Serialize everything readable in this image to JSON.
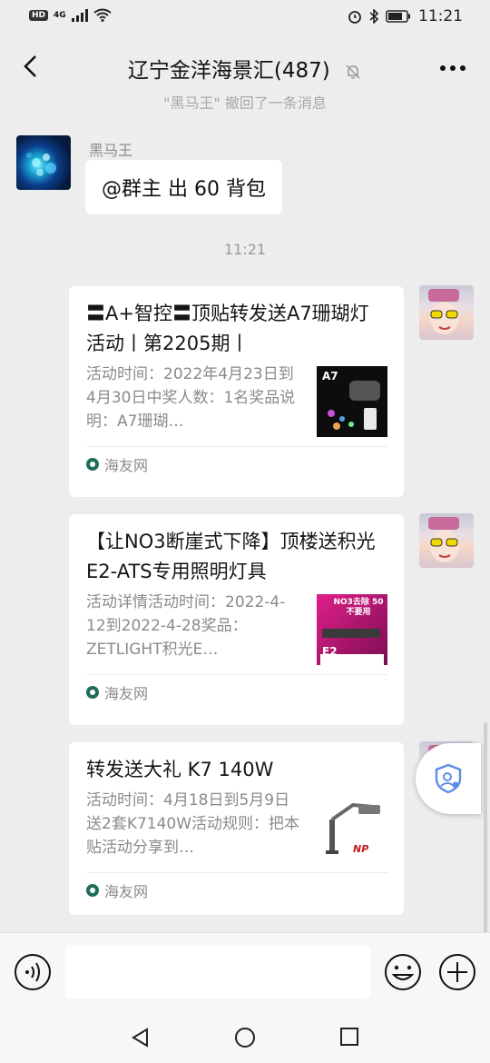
{
  "status_bar": {
    "hd": "HD",
    "network": "4G",
    "time": "11:21"
  },
  "header": {
    "title": "辽宁金洋海景汇(487)",
    "back_icon": "chevron-left-icon",
    "mute_icon": "bell-off-icon",
    "more_icon": "more-dots-icon"
  },
  "system_message": "\"黑马王\" 撤回了一条消息",
  "messages": [
    {
      "sender": "黑马王",
      "text": "@群主  出 60 背包"
    }
  ],
  "timestamp": "11:21",
  "link_cards": [
    {
      "title": "〓A+智控〓顶贴转发送A7珊瑚灯活动丨第2205期丨",
      "desc": "活动时间：2022年4月23日到4月30日中奖人数：1名奖品说明：A7珊瑚…",
      "thumb_text": "A7",
      "source": "海友网"
    },
    {
      "title": "【让NO3断崖式下降】顶楼送积光E2-ATS专用照明灯具",
      "desc": "活动详情活动时间：2022-4-12到2022-4-28奖品：ZETLIGHT积光E…",
      "thumb_text": "NO3去除 50不要用",
      "thumb_sub": "E2",
      "source": "海友网"
    },
    {
      "title": "转发送大礼 K7 140W",
      "desc": "活动时间：4月18日到5月9日送2套K7140W活动规则：把本贴活动分享到…",
      "thumb_text": "NP",
      "source": "海友网"
    }
  ],
  "floating_button": {
    "icon": "shield-icon"
  },
  "input_bar": {
    "voice_icon": "voice-icon",
    "emoji_icon": "emoji-icon",
    "plus_icon": "plus-icon",
    "placeholder": ""
  },
  "system_nav": {
    "back_icon": "nav-back-icon",
    "home_icon": "nav-home-icon",
    "recents_icon": "nav-recents-icon"
  }
}
